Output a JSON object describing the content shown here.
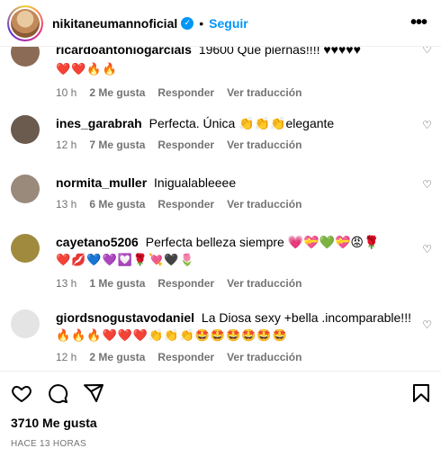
{
  "header": {
    "username": "nikitaneumannoficial",
    "separator": "•",
    "follow_label": "Seguir",
    "more_label": "•••"
  },
  "comments": [
    {
      "username": "ricardoantoniogarcials",
      "text": "19600 Que piernas!!!! ♥♥♥♥♥",
      "emojis": "❤️❤️🔥🔥",
      "time": "10 h",
      "likes": "2 Me gusta",
      "reply": "Responder",
      "translate": "Ver traducción"
    },
    {
      "username": "ines_garabrah",
      "text": "Perfecta. Única 👏👏👏elegante",
      "time": "12 h",
      "likes": "7 Me gusta",
      "reply": "Responder",
      "translate": "Ver traducción"
    },
    {
      "username": "normita_muller",
      "text": "Inigualableeee",
      "time": "13 h",
      "likes": "6 Me gusta",
      "reply": "Responder",
      "translate": "Ver traducción"
    },
    {
      "username": "cayetano5206",
      "text": "Perfecta belleza siempre 💗💝💚💝😡🌹",
      "emojis": "❤️💋💙💜💟🌹💘🖤🌷",
      "time": "13 h",
      "likes": "1 Me gusta",
      "reply": "Responder",
      "translate": "Ver traducción"
    },
    {
      "username": "giordsnogustavodaniel",
      "text": "La Diosa sexy +bella .incomparable!!!",
      "emojis": "🔥🔥🔥❤️❤️❤️👏👏👏🤩🤩🤩🤩🤩🤩",
      "time": "12 h",
      "likes": "2 Me gusta",
      "reply": "Responder",
      "translate": "Ver traducción"
    }
  ],
  "footer": {
    "likes": "3710 Me gusta",
    "time_ago": "HACE 13 HORAS"
  },
  "colors": {
    "accent": "#0095f6",
    "muted": "#737373",
    "divider": "#efefef"
  },
  "icons": [
    "heart-icon",
    "comment-icon",
    "share-icon",
    "bookmark-icon",
    "verified-icon",
    "more-icon"
  ]
}
